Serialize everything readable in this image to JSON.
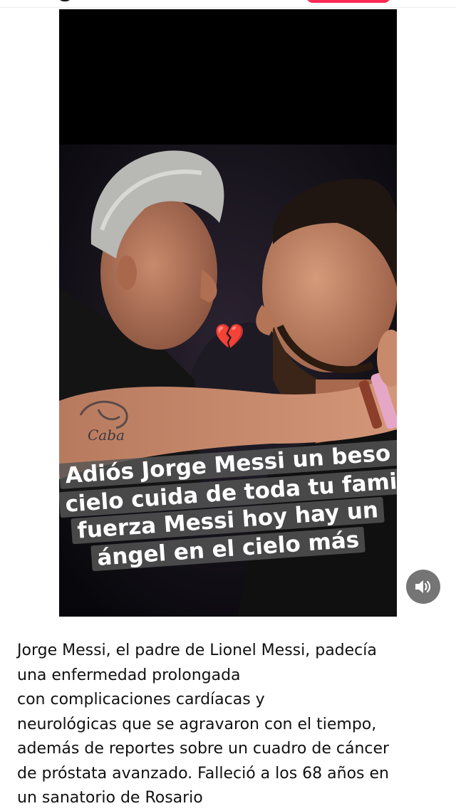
{
  "video": {
    "caption_lines": [
      "Adiós Jorge Messi un beso al",
      "cielo cuida de toda tu familia",
      "fuerza  Messi hoy hay un",
      "ángel en el cielo más"
    ],
    "emoji": "💔",
    "tattoo_text": "Caba",
    "sound_button_icon": "speaker-sound-icon"
  },
  "article": {
    "lines": [
      "Jorge Messi, el padre de Lionel Messi, padecía",
      "una enfermedad prolongada",
      "con complicaciones cardíacas y",
      "neurológicas que se agravaron con el tiempo,",
      "además de reportes sobre un cuadro de cáncer",
      "de próstata avanzado. Falleció a los 68 años en",
      "un sanatorio de Rosario"
    ]
  },
  "colors": {
    "top_button": "#ff2a55",
    "caption_bg": "#555555",
    "sound_button_bg": "#757575"
  }
}
